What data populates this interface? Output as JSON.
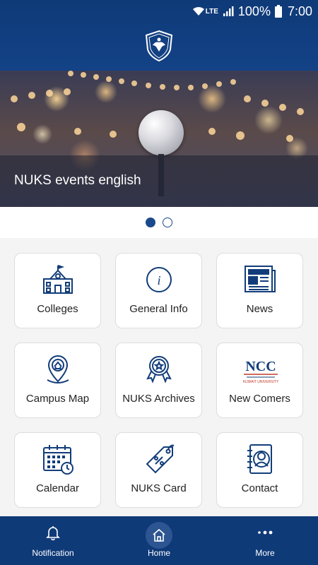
{
  "status_bar": {
    "network": "LTE",
    "battery": "100%",
    "time": "7:00"
  },
  "banner": {
    "caption": "NUKS events english"
  },
  "carousel": {
    "page_count": 2,
    "current_page": 1
  },
  "tiles": [
    {
      "label": "Colleges",
      "icon": "school-building-icon"
    },
    {
      "label": "General Info",
      "icon": "info-icon"
    },
    {
      "label": "News",
      "icon": "newspaper-icon"
    },
    {
      "label": "Campus Map",
      "icon": "map-pin-icon"
    },
    {
      "label": "NUKS Archives",
      "icon": "award-ribbon-icon"
    },
    {
      "label": "New Comers",
      "icon": "ncc-logo-icon",
      "logo_text": "NCC",
      "logo_subtext": "KUWAIT UNIVERSITY"
    },
    {
      "label": "Calendar",
      "icon": "calendar-icon"
    },
    {
      "label": "NUKS Card",
      "icon": "discount-tag-icon"
    },
    {
      "label": "Contact",
      "icon": "contact-book-icon"
    }
  ],
  "bottom_nav": [
    {
      "label": "Notification",
      "icon": "bell-icon"
    },
    {
      "label": "Home",
      "icon": "home-icon",
      "selected": true
    },
    {
      "label": "More",
      "icon": "more-dots-icon"
    }
  ],
  "colors": {
    "primary": "#0f3a78",
    "accent": "#1a4a8c",
    "tile_border": "#dddddd",
    "background": "#f4f4f4"
  }
}
